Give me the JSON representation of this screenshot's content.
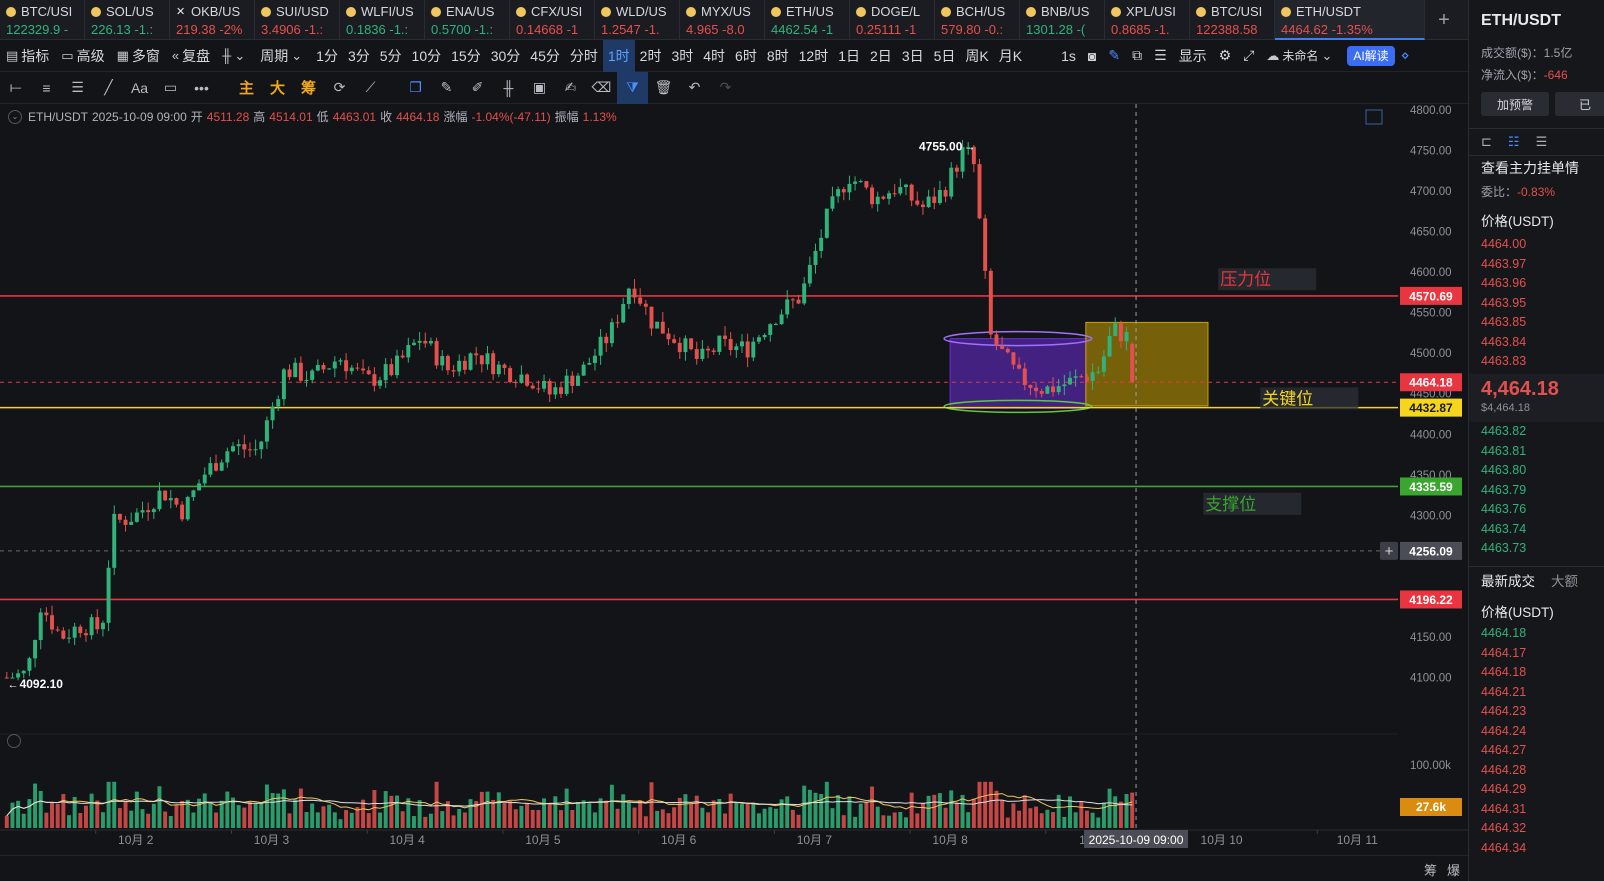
{
  "tickers": [
    {
      "name": "BTC/USI",
      "price": "122329.9 -",
      "dir": "up",
      "icon": "coin-icon"
    },
    {
      "name": "SOL/US",
      "price": "226.13 -1.:",
      "dir": "up",
      "icon": "coin-icon"
    },
    {
      "name": "OKB/US",
      "price": "219.38 -2%",
      "dir": "down",
      "icon": "close-icon"
    },
    {
      "name": "SUI/USD",
      "price": "3.4906 -1.:",
      "dir": "down",
      "icon": "coin-icon"
    },
    {
      "name": "WLFI/US",
      "price": "0.1836 -1.:",
      "dir": "up",
      "icon": "coin-icon"
    },
    {
      "name": "ENA/US",
      "price": "0.5700 -1.:",
      "dir": "up",
      "icon": "coin-icon"
    },
    {
      "name": "CFX/USI",
      "price": "0.14668 -1",
      "dir": "down",
      "icon": "coin-icon"
    },
    {
      "name": "WLD/US",
      "price": "1.2547 -1.",
      "dir": "down",
      "icon": "coin-icon"
    },
    {
      "name": "MYX/US",
      "price": "4.965 -8.0",
      "dir": "down",
      "icon": "coin-icon"
    },
    {
      "name": "ETH/US",
      "price": "4462.54 -1",
      "dir": "up",
      "icon": "coin-icon"
    },
    {
      "name": "DOGE/L",
      "price": "0.25111 -1",
      "dir": "down",
      "icon": "coin-icon"
    },
    {
      "name": "BCH/US",
      "price": "579.80 -0.:",
      "dir": "down",
      "icon": "coin-icon"
    },
    {
      "name": "BNB/US",
      "price": "1301.28 -(",
      "dir": "up",
      "icon": "coin-icon"
    },
    {
      "name": "XPL/USI",
      "price": "0.8685 -1.",
      "dir": "down",
      "icon": "coin-icon"
    },
    {
      "name": "BTC/USI",
      "price": "122388.58",
      "dir": "down",
      "icon": "coin-icon"
    },
    {
      "name": "ETH/USDT",
      "price": "4464.62 -1.35%",
      "dir": "down",
      "icon": "coin-icon",
      "active": true
    }
  ],
  "toolbar": {
    "indicators": "指标",
    "advanced": "高级",
    "multi_window": "多窗",
    "replay": "复盘",
    "period": "周期",
    "periods": [
      "1分",
      "3分",
      "5分",
      "10分",
      "15分",
      "30分",
      "45分",
      "分时",
      "1时",
      "2时",
      "3时",
      "4时",
      "6时",
      "8时",
      "12时",
      "1日",
      "2日",
      "3日",
      "5日",
      "周K",
      "月K"
    ],
    "active_period": "1时",
    "seconds": "1s",
    "display": "显示",
    "layout_name": "未命名",
    "ai_button": "AI解读"
  },
  "draw_toolbar": {
    "main_label": "主",
    "big_label": "大",
    "chips_label": "筹",
    "text_tool": "Aa",
    "more": "•••"
  },
  "ohlc": {
    "symbol": "ETH/USDT",
    "time": "2025-10-09 09:00",
    "open_label": "开",
    "open": "4511.28",
    "high_label": "高",
    "high": "4514.01",
    "low_label": "低",
    "low": "4463.01",
    "close_label": "收",
    "close": "4464.18",
    "change_label": "涨幅",
    "change": "-1.04%(-47.11)",
    "amp_label": "振幅",
    "amp": "1.13%"
  },
  "chart_data": {
    "type": "candlestick",
    "symbol": "ETH/USDT",
    "interval": "1时",
    "ylim": [
      4050,
      4800
    ],
    "y_ticks": [
      4800,
      4750,
      4700,
      4650,
      4600,
      4550,
      4500,
      4450,
      4400,
      4350,
      4300,
      4250,
      4200,
      4150,
      4100
    ],
    "y_tick_labels": [
      "4800.00",
      "4750.00",
      "4700.00",
      "4650.00",
      "4600.00",
      "4550.00",
      "4500.00",
      "4450.00",
      "4400.00",
      "4350.00",
      "4300.00",
      "4250.00",
      "4200.00",
      "4150.00",
      "4100.00"
    ],
    "x_labels": [
      "10月 2",
      "10月 3",
      "10月 4",
      "10月 5",
      "10月 6",
      "10月 7",
      "10月 8",
      "10",
      "10月 10",
      "10月 11"
    ],
    "x_label_days": [
      2,
      3,
      4,
      5,
      6,
      7,
      8,
      9,
      10,
      11
    ],
    "time_range_days": [
      1.0,
      11.3
    ],
    "crosshair_label": "2025-10-09 09:00",
    "crosshair_day": 9.37,
    "anchors": [
      {
        "day": 1.05,
        "price": 4100
      },
      {
        "day": 1.2,
        "price": 4105
      },
      {
        "day": 1.3,
        "price": 4190
      },
      {
        "day": 1.45,
        "price": 4150
      },
      {
        "day": 1.6,
        "price": 4165
      },
      {
        "day": 1.75,
        "price": 4160
      },
      {
        "day": 1.83,
        "price": 4290
      },
      {
        "day": 2.0,
        "price": 4300
      },
      {
        "day": 2.2,
        "price": 4330
      },
      {
        "day": 2.35,
        "price": 4305
      },
      {
        "day": 2.5,
        "price": 4350
      },
      {
        "day": 2.7,
        "price": 4385
      },
      {
        "day": 2.9,
        "price": 4380
      },
      {
        "day": 3.1,
        "price": 4480
      },
      {
        "day": 3.3,
        "price": 4470
      },
      {
        "day": 3.5,
        "price": 4495
      },
      {
        "day": 3.7,
        "price": 4465
      },
      {
        "day": 3.9,
        "price": 4480
      },
      {
        "day": 4.1,
        "price": 4520
      },
      {
        "day": 4.3,
        "price": 4480
      },
      {
        "day": 4.5,
        "price": 4500
      },
      {
        "day": 4.7,
        "price": 4480
      },
      {
        "day": 4.9,
        "price": 4470
      },
      {
        "day": 5.05,
        "price": 4450
      },
      {
        "day": 5.3,
        "price": 4480
      },
      {
        "day": 5.5,
        "price": 4525
      },
      {
        "day": 5.65,
        "price": 4590
      },
      {
        "day": 5.8,
        "price": 4540
      },
      {
        "day": 6.0,
        "price": 4515
      },
      {
        "day": 6.15,
        "price": 4490
      },
      {
        "day": 6.3,
        "price": 4510
      },
      {
        "day": 6.5,
        "price": 4505
      },
      {
        "day": 6.7,
        "price": 4545
      },
      {
        "day": 6.9,
        "price": 4570
      },
      {
        "day": 7.1,
        "price": 4670
      },
      {
        "day": 7.25,
        "price": 4720
      },
      {
        "day": 7.45,
        "price": 4690
      },
      {
        "day": 7.6,
        "price": 4705
      },
      {
        "day": 7.8,
        "price": 4680
      },
      {
        "day": 7.95,
        "price": 4700
      },
      {
        "day": 8.1,
        "price": 4750
      },
      {
        "day": 8.17,
        "price": 4740
      },
      {
        "day": 8.3,
        "price": 4520
      },
      {
        "day": 8.5,
        "price": 4470
      },
      {
        "day": 8.7,
        "price": 4455
      },
      {
        "day": 8.9,
        "price": 4465
      },
      {
        "day": 9.1,
        "price": 4480
      },
      {
        "day": 9.2,
        "price": 4530
      },
      {
        "day": 9.35,
        "price": 4515
      },
      {
        "day": 9.37,
        "price": 4464
      }
    ],
    "high_marker": {
      "label": "4755.00",
      "day": 8.12,
      "price": 4755
    },
    "low_marker": {
      "label": "4092.10",
      "day": 1.1,
      "price": 4092.1
    },
    "horizontal_lines": [
      {
        "price": 4570.69,
        "label": "4570.69",
        "color": "#e8353f",
        "style": "solid"
      },
      {
        "price": 4464.18,
        "label": "4464.18",
        "color": "#e8353f",
        "style": "dashed"
      },
      {
        "price": 4432.87,
        "label": "4432.87",
        "color": "#f5d61c",
        "style": "solid"
      },
      {
        "price": 4335.59,
        "label": "4335.59",
        "color": "#3aa52f",
        "style": "solid"
      },
      {
        "price": 4256.09,
        "label": "4256.09",
        "color": "#8a8d93",
        "style": "dashed"
      },
      {
        "price": 4196.22,
        "label": "4196.22",
        "color": "#e8353f",
        "style": "solid"
      }
    ],
    "annotations": [
      {
        "text": "压力位",
        "day": 9.99,
        "price": 4590,
        "color": "#e8353f"
      },
      {
        "text": "关键位",
        "day": 10.3,
        "price": 4443,
        "color": "#f5d61c"
      },
      {
        "text": "支撑位",
        "day": 9.88,
        "price": 4313,
        "color": "#3aa52f"
      }
    ],
    "range_boxes": [
      {
        "day_from": 8.0,
        "day_to": 9.0,
        "price_top": 4518,
        "price_bottom": 4432,
        "color": "#6c2bd9"
      },
      {
        "day_from": 9.0,
        "day_to": 9.9,
        "price_top": 4538,
        "price_bottom": 4435,
        "color": "#c9a000"
      }
    ],
    "volume_label": "100.00k",
    "volume_current": "27.6k"
  },
  "bottom": {
    "badge_a": "筹",
    "badge_b": "爆"
  },
  "right_panel": {
    "pair": "ETH/USDT",
    "turnover_label": "成交额($)：",
    "turnover": "1.5亿",
    "net_inflow_label": "净流入($)：",
    "net_inflow": "-646",
    "alert_button": "加预警",
    "other_button": "已",
    "orderbook_title": "查看主力挂单情",
    "ratio_label": "委比：",
    "ratio": "-0.83%",
    "price_header": "价格(USDT)",
    "asks": [
      "4464.00",
      "4463.97",
      "4463.96",
      "4463.95",
      "4463.85",
      "4463.84",
      "4463.83"
    ],
    "last_price": "4,464.18",
    "last_price_usd": "$4,464.18",
    "bids": [
      "4463.82",
      "4463.81",
      "4463.80",
      "4463.79",
      "4463.76",
      "4463.74",
      "4463.73"
    ],
    "trades_title": "最新成交",
    "trades_tab2": "大额",
    "trades_price_header": "价格(USDT)",
    "trades": [
      {
        "p": "4464.18",
        "c": "green"
      },
      {
        "p": "4464.17",
        "c": "red"
      },
      {
        "p": "4464.18",
        "c": "red"
      },
      {
        "p": "4464.21",
        "c": "red"
      },
      {
        "p": "4464.23",
        "c": "red"
      },
      {
        "p": "4464.24",
        "c": "red"
      },
      {
        "p": "4464.27",
        "c": "red"
      },
      {
        "p": "4464.28",
        "c": "red"
      },
      {
        "p": "4464.29",
        "c": "red"
      },
      {
        "p": "4464.31",
        "c": "red"
      },
      {
        "p": "4464.32",
        "c": "red"
      },
      {
        "p": "4464.34",
        "c": "red"
      }
    ]
  },
  "colors": {
    "up": "#2fb37a",
    "down": "#e4504d",
    "accent": "#3d7cf4",
    "background": "#131418"
  }
}
